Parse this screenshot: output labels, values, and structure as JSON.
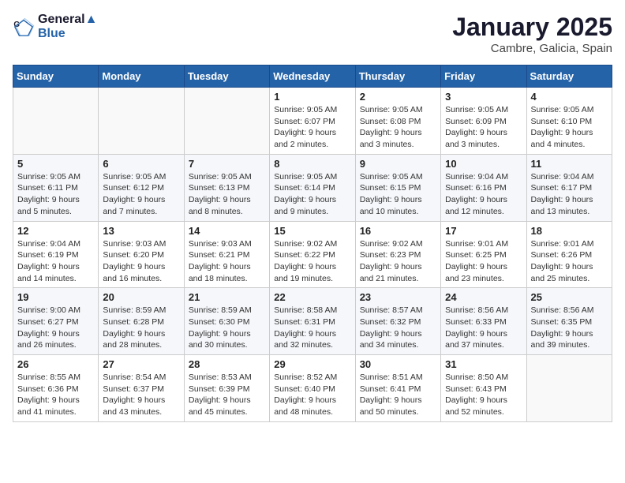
{
  "header": {
    "logo_line1": "General",
    "logo_line2": "Blue",
    "month_title": "January 2025",
    "location": "Cambre, Galicia, Spain"
  },
  "weekdays": [
    "Sunday",
    "Monday",
    "Tuesday",
    "Wednesday",
    "Thursday",
    "Friday",
    "Saturday"
  ],
  "weeks": [
    [
      {
        "day": "",
        "info": ""
      },
      {
        "day": "",
        "info": ""
      },
      {
        "day": "",
        "info": ""
      },
      {
        "day": "1",
        "info": "Sunrise: 9:05 AM\nSunset: 6:07 PM\nDaylight: 9 hours and 2 minutes."
      },
      {
        "day": "2",
        "info": "Sunrise: 9:05 AM\nSunset: 6:08 PM\nDaylight: 9 hours and 3 minutes."
      },
      {
        "day": "3",
        "info": "Sunrise: 9:05 AM\nSunset: 6:09 PM\nDaylight: 9 hours and 3 minutes."
      },
      {
        "day": "4",
        "info": "Sunrise: 9:05 AM\nSunset: 6:10 PM\nDaylight: 9 hours and 4 minutes."
      }
    ],
    [
      {
        "day": "5",
        "info": "Sunrise: 9:05 AM\nSunset: 6:11 PM\nDaylight: 9 hours and 5 minutes."
      },
      {
        "day": "6",
        "info": "Sunrise: 9:05 AM\nSunset: 6:12 PM\nDaylight: 9 hours and 7 minutes."
      },
      {
        "day": "7",
        "info": "Sunrise: 9:05 AM\nSunset: 6:13 PM\nDaylight: 9 hours and 8 minutes."
      },
      {
        "day": "8",
        "info": "Sunrise: 9:05 AM\nSunset: 6:14 PM\nDaylight: 9 hours and 9 minutes."
      },
      {
        "day": "9",
        "info": "Sunrise: 9:05 AM\nSunset: 6:15 PM\nDaylight: 9 hours and 10 minutes."
      },
      {
        "day": "10",
        "info": "Sunrise: 9:04 AM\nSunset: 6:16 PM\nDaylight: 9 hours and 12 minutes."
      },
      {
        "day": "11",
        "info": "Sunrise: 9:04 AM\nSunset: 6:17 PM\nDaylight: 9 hours and 13 minutes."
      }
    ],
    [
      {
        "day": "12",
        "info": "Sunrise: 9:04 AM\nSunset: 6:19 PM\nDaylight: 9 hours and 14 minutes."
      },
      {
        "day": "13",
        "info": "Sunrise: 9:03 AM\nSunset: 6:20 PM\nDaylight: 9 hours and 16 minutes."
      },
      {
        "day": "14",
        "info": "Sunrise: 9:03 AM\nSunset: 6:21 PM\nDaylight: 9 hours and 18 minutes."
      },
      {
        "day": "15",
        "info": "Sunrise: 9:02 AM\nSunset: 6:22 PM\nDaylight: 9 hours and 19 minutes."
      },
      {
        "day": "16",
        "info": "Sunrise: 9:02 AM\nSunset: 6:23 PM\nDaylight: 9 hours and 21 minutes."
      },
      {
        "day": "17",
        "info": "Sunrise: 9:01 AM\nSunset: 6:25 PM\nDaylight: 9 hours and 23 minutes."
      },
      {
        "day": "18",
        "info": "Sunrise: 9:01 AM\nSunset: 6:26 PM\nDaylight: 9 hours and 25 minutes."
      }
    ],
    [
      {
        "day": "19",
        "info": "Sunrise: 9:00 AM\nSunset: 6:27 PM\nDaylight: 9 hours and 26 minutes."
      },
      {
        "day": "20",
        "info": "Sunrise: 8:59 AM\nSunset: 6:28 PM\nDaylight: 9 hours and 28 minutes."
      },
      {
        "day": "21",
        "info": "Sunrise: 8:59 AM\nSunset: 6:30 PM\nDaylight: 9 hours and 30 minutes."
      },
      {
        "day": "22",
        "info": "Sunrise: 8:58 AM\nSunset: 6:31 PM\nDaylight: 9 hours and 32 minutes."
      },
      {
        "day": "23",
        "info": "Sunrise: 8:57 AM\nSunset: 6:32 PM\nDaylight: 9 hours and 34 minutes."
      },
      {
        "day": "24",
        "info": "Sunrise: 8:56 AM\nSunset: 6:33 PM\nDaylight: 9 hours and 37 minutes."
      },
      {
        "day": "25",
        "info": "Sunrise: 8:56 AM\nSunset: 6:35 PM\nDaylight: 9 hours and 39 minutes."
      }
    ],
    [
      {
        "day": "26",
        "info": "Sunrise: 8:55 AM\nSunset: 6:36 PM\nDaylight: 9 hours and 41 minutes."
      },
      {
        "day": "27",
        "info": "Sunrise: 8:54 AM\nSunset: 6:37 PM\nDaylight: 9 hours and 43 minutes."
      },
      {
        "day": "28",
        "info": "Sunrise: 8:53 AM\nSunset: 6:39 PM\nDaylight: 9 hours and 45 minutes."
      },
      {
        "day": "29",
        "info": "Sunrise: 8:52 AM\nSunset: 6:40 PM\nDaylight: 9 hours and 48 minutes."
      },
      {
        "day": "30",
        "info": "Sunrise: 8:51 AM\nSunset: 6:41 PM\nDaylight: 9 hours and 50 minutes."
      },
      {
        "day": "31",
        "info": "Sunrise: 8:50 AM\nSunset: 6:43 PM\nDaylight: 9 hours and 52 minutes."
      },
      {
        "day": "",
        "info": ""
      }
    ]
  ]
}
